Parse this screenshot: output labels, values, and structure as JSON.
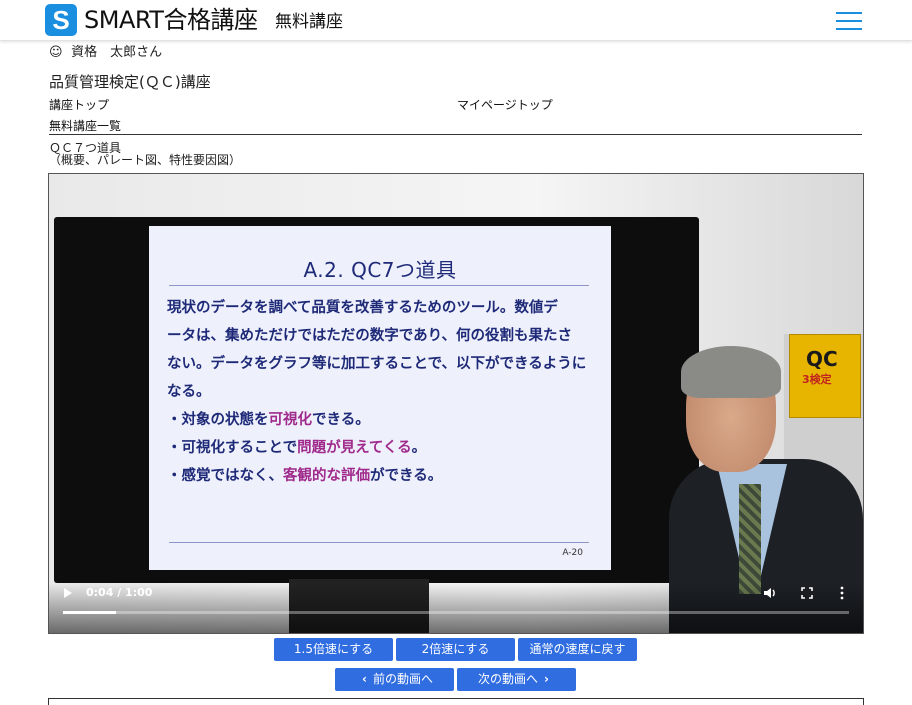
{
  "header": {
    "logo_letter": "S",
    "brand": "SMART合格講座",
    "subtitle": "無料講座",
    "menu_icon": "hamburger-menu-icon",
    "accent_color": "#1a8fe0"
  },
  "user": {
    "icon": "smiley-icon",
    "icon_glyph": "☺",
    "name": "資格　太郎さん"
  },
  "course_title": "品質管理検定(ＱＣ)講座",
  "nav": {
    "course_top": "講座トップ",
    "mypage_top": "マイページトップ",
    "free_list": "無料講座一覧"
  },
  "lesson_title": "ＱＣ７つ道具\n（概要、パレート図、特性要因図）",
  "video": {
    "slide_title": "A.2. QC7つ道具",
    "slide_lines": [
      "現状のデータを調べて品質を改善するためのツール。数値デ",
      "ータは、集めただけではただの数字であり、何の役割も果たさ",
      "ない。データをグラフ等に加工することで、以下ができるように",
      "なる。"
    ],
    "bullet1_pre": "・対象の状態を",
    "bullet1_hl": "可視化",
    "bullet1_post": "できる。",
    "bullet2_pre": "・可視化することで",
    "bullet2_hl": "問題が見えてくる",
    "bullet2_post": "。",
    "bullet3_pre": "・感覚ではなく、",
    "bullet3_hl": "客観的な評価",
    "bullet3_post": "ができる。",
    "slide_number": "A-20",
    "book_title": "QC",
    "book_sub": "3検定",
    "time": "0:04 / 1:00",
    "progress": 0.067,
    "controls": {
      "play": "play-icon",
      "volume": "volume-icon",
      "fullscreen": "fullscreen-icon",
      "more": "more-vert-icon"
    }
  },
  "buttons": {
    "speed_15": "1.5倍速にする",
    "speed_2": "2倍速にする",
    "speed_normal": "通常の速度に戻す",
    "prev": "前の動画へ",
    "next": "次の動画へ",
    "color": "#2f6de1"
  }
}
